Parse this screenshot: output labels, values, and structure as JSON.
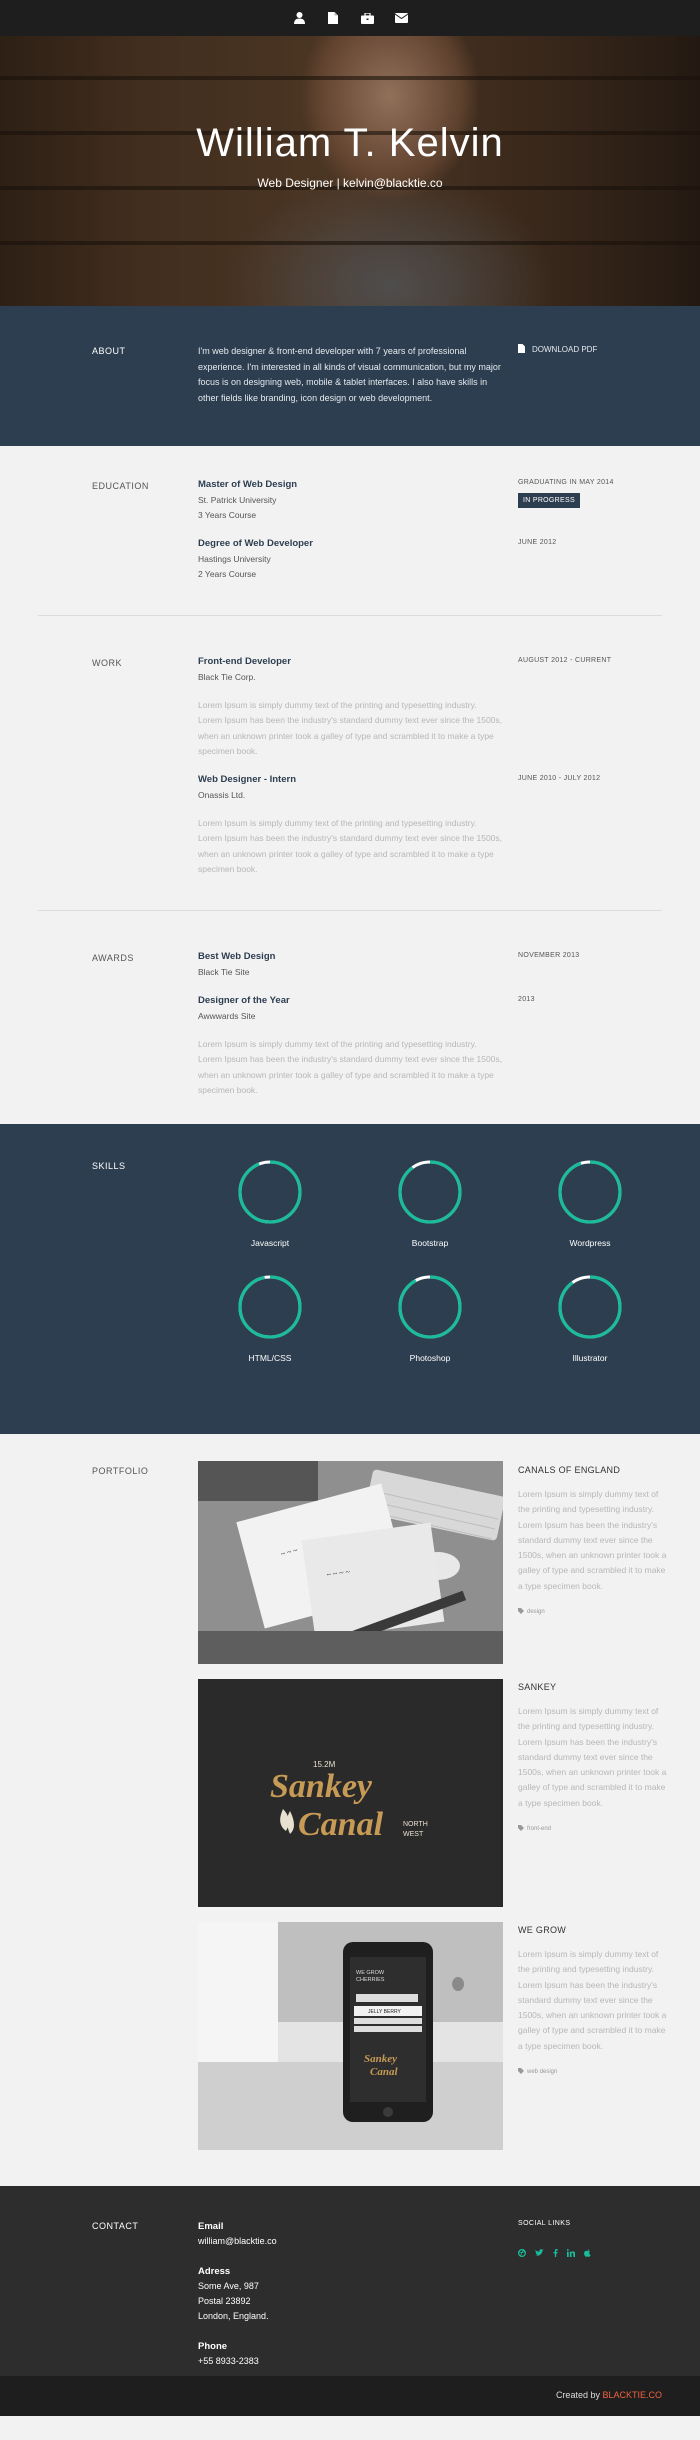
{
  "nav": {
    "icons": [
      "user-icon",
      "document-icon",
      "briefcase-icon",
      "envelope-icon"
    ]
  },
  "hero": {
    "name": "William T. Kelvin",
    "subtitle": "Web Designer | kelvin@blacktie.co"
  },
  "about": {
    "label": "ABOUT",
    "text": "I'm web designer & front-end developer with 7 years of professional experience. I'm interested in all kinds of visual communication, but my major focus is on designing web, mobile & tablet interfaces. I also have skills in other fields like branding, icon design or web development.",
    "download_label": "DOWNLOAD PDF"
  },
  "education": {
    "label": "EDUCATION",
    "items": [
      {
        "title": "Master of Web Design",
        "line1": "St. Patrick University",
        "line2": "3 Years Course",
        "date": "GRADUATING IN MAY 2014",
        "badge": "IN PROGRESS"
      },
      {
        "title": "Degree of Web Developer",
        "line1": "Hastings University",
        "line2": "2 Years Course",
        "date": "JUNE 2012"
      }
    ]
  },
  "work": {
    "label": "WORK",
    "items": [
      {
        "title": "Front-end Developer",
        "company": "Black Tie Corp.",
        "text": "Lorem Ipsum is simply dummy text of the printing and typesetting industry. Lorem Ipsum has been the industry's standard dummy text ever since the 1500s, when an unknown printer took a galley of type and scrambled it to make a type specimen book.",
        "date": "AUGUST 2012 - CURRENT"
      },
      {
        "title": "Web Designer - Intern",
        "company": "Onassis Ltd.",
        "text": "Lorem Ipsum is simply dummy text of the printing and typesetting industry. Lorem Ipsum has been the industry's standard dummy text ever since the 1500s, when an unknown printer took a galley of type and scrambled it to make a type specimen book.",
        "date": "JUNE 2010 - JULY 2012"
      }
    ]
  },
  "awards": {
    "label": "AWARDS",
    "items": [
      {
        "title": "Best Web Design",
        "org": "Black Tie Site",
        "date": "NOVEMBER 2013"
      },
      {
        "title": "Designer of the Year",
        "org": "Awwwards Site",
        "date": "2013"
      }
    ],
    "text": "Lorem Ipsum is simply dummy text of the printing and typesetting industry. Lorem Ipsum has been the industry's standard dummy text ever since the 1500s, when an unknown printer took a galley of type and scrambled it to make a type specimen book."
  },
  "skills": {
    "label": "SKILLS",
    "ring_color": "#1abc9c",
    "items": [
      {
        "name": "Javascript",
        "level": 0.94
      },
      {
        "name": "Bootstrap",
        "level": 0.9
      },
      {
        "name": "Wordpress",
        "level": 0.95
      },
      {
        "name": "HTML/CSS",
        "level": 0.97
      },
      {
        "name": "Photoshop",
        "level": 0.92
      },
      {
        "name": "Illustrator",
        "level": 0.9
      }
    ]
  },
  "portfolio": {
    "label": "PORTFOLIO",
    "items": [
      {
        "title": "CANALS OF ENGLAND",
        "text": "Lorem Ipsum is simply dummy text of the printing and typesetting industry. Lorem Ipsum has been the industry's standard dummy text ever since the 1500s, when an unknown printer took a galley of type and scrambled it to make a type specimen book.",
        "tag": "design"
      },
      {
        "title": "SANKEY",
        "text": "Lorem Ipsum is simply dummy text of the printing and typesetting industry. Lorem Ipsum has been the industry's standard dummy text ever since the 1500s, when an unknown printer took a galley of type and scrambled it to make a type specimen book.",
        "tag": "front-end",
        "poster": {
          "top": "15.2M",
          "l1": "Sankey",
          "l2": "Canal",
          "right": "NORTH",
          "right2": "WEST"
        }
      },
      {
        "title": "WE GROW",
        "text": "Lorem Ipsum is simply dummy text of the printing and typesetting industry. Lorem Ipsum has been the industry's standard dummy text ever since the 1500s, when an unknown printer took a galley of type and scrambled it to make a type specimen book.",
        "tag": "web design",
        "phone": {
          "l1": "WE GROW",
          "l2": "CHERRIES",
          "l3": "JELLY BERRY",
          "l4": "Sankey",
          "l5": "Canal"
        }
      }
    ]
  },
  "contact": {
    "label": "CONTACT",
    "email_label": "Email",
    "email": "william@blacktie.co",
    "address_label": "Adress",
    "address_lines": [
      "Some Ave, 987",
      "Postal 23892",
      "London, England."
    ],
    "phone_label": "Phone",
    "phone": "+55 8933-2383",
    "social_label": "SOCIAL LINKS",
    "social_color": "#1abc9c",
    "social_icons": [
      "dribbble-icon",
      "twitter-icon",
      "facebook-icon",
      "linkedin-icon",
      "apple-icon"
    ]
  },
  "footer": {
    "created_by": "Created by",
    "brand": "BLACKTIE.CO",
    "brand_color": "#f0633f"
  }
}
